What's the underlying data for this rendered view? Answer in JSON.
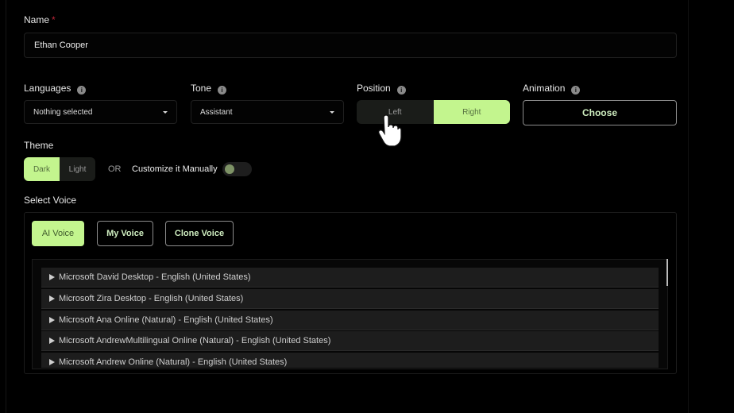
{
  "name_field": {
    "label": "Name",
    "required_mark": "*",
    "value": "Ethan Cooper"
  },
  "languages": {
    "label": "Languages",
    "value": "Nothing selected"
  },
  "tone": {
    "label": "Tone",
    "value": "Assistant"
  },
  "position": {
    "label": "Position",
    "options": [
      "Left",
      "Right"
    ],
    "selected": "Right"
  },
  "animation": {
    "label": "Animation",
    "button": "Choose"
  },
  "theme": {
    "label": "Theme",
    "options": [
      "Dark",
      "Light"
    ],
    "selected": "Dark",
    "or": "OR",
    "customize_label": "Customize it Manually",
    "customize_on": false
  },
  "voice": {
    "label": "Select Voice",
    "tabs": [
      "AI Voice",
      "My Voice",
      "Clone Voice"
    ],
    "selected_tab": "AI Voice",
    "items": [
      "Microsoft David Desktop - English (United States)",
      "Microsoft Zira Desktop - English (United States)",
      "Microsoft Ana Online (Natural) - English (United States)",
      "Microsoft AndrewMultilingual Online (Natural) - English (United States)",
      "Microsoft Andrew Online (Natural) - English (United States)"
    ]
  },
  "colors": {
    "accent": "#c3f58e",
    "background": "#000000"
  }
}
